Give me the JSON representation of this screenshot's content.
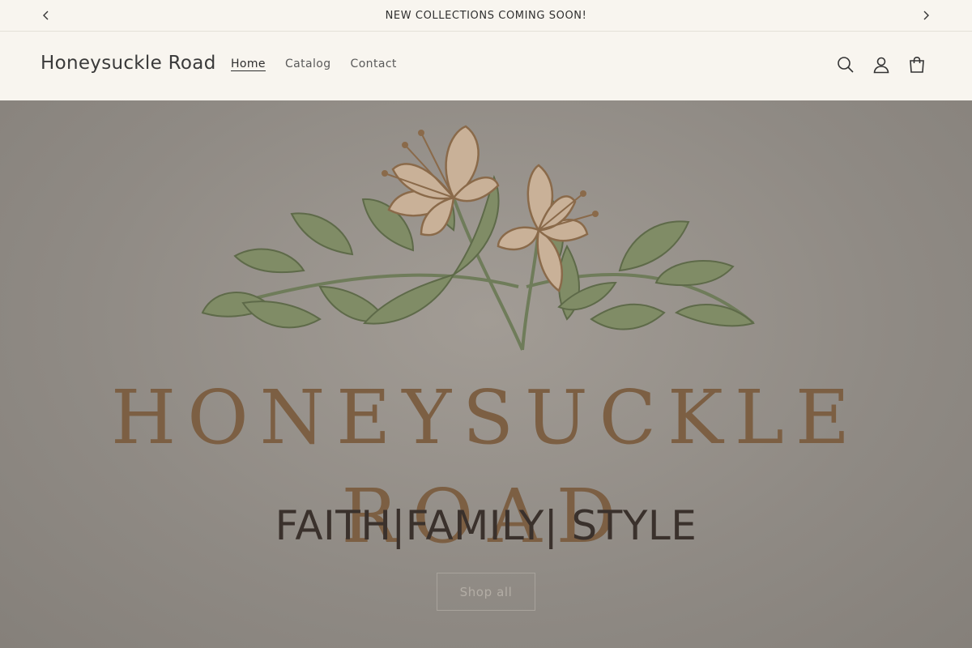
{
  "announcement": {
    "text": "NEW COLLECTIONS COMING SOON!",
    "prev_icon": "chevron-left-icon",
    "next_icon": "chevron-right-icon"
  },
  "header": {
    "logo": "Honeysuckle Road",
    "nav": [
      {
        "label": "Home",
        "active": true
      },
      {
        "label": "Catalog",
        "active": false
      },
      {
        "label": "Contact",
        "active": false
      }
    ],
    "icons": [
      "search-icon",
      "account-icon",
      "cart-icon"
    ]
  },
  "hero": {
    "brand_line_1": "HONEYSUCKLE",
    "brand_line_2": "ROAD",
    "heading": "FAITH|FAMILY| STYLE",
    "button_label": "Shop all"
  },
  "colors": {
    "page_bg": "#f8f5ef",
    "hero_bg": "#8e8a85",
    "brand_brown": "#7c5f43",
    "leaf_green": "#7e8b64",
    "petal": "#c9b198"
  }
}
